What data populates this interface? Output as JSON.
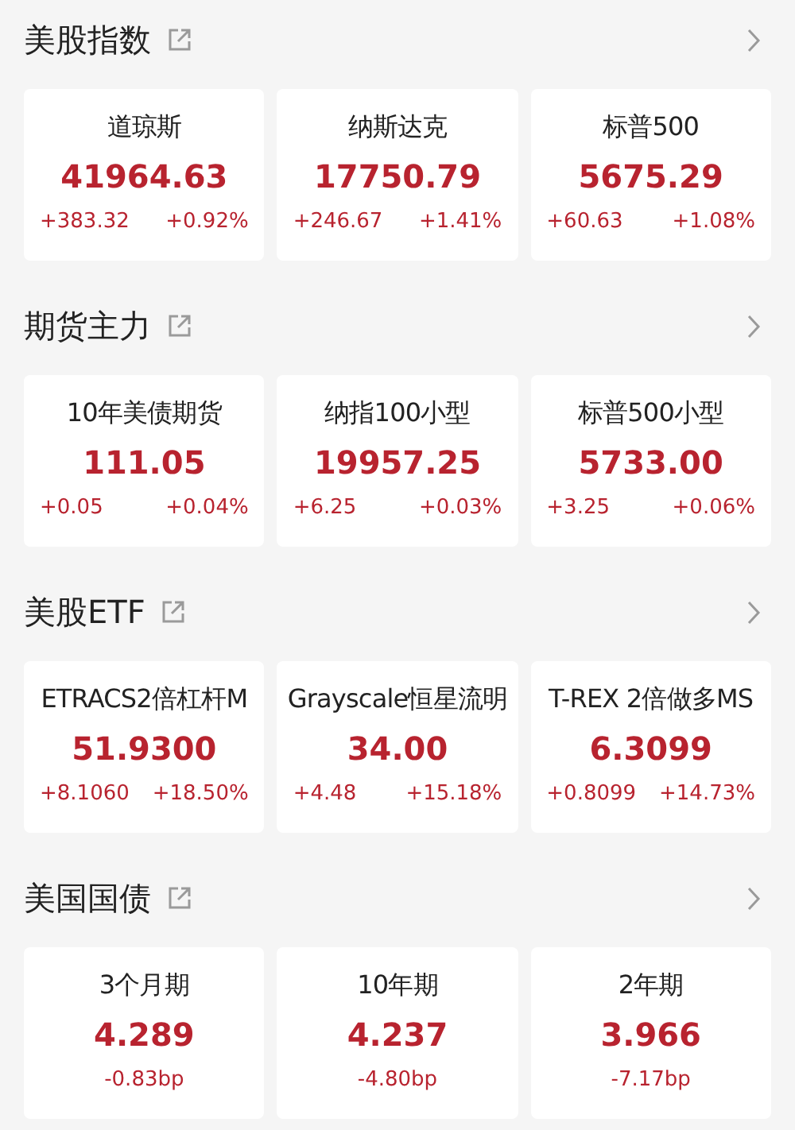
{
  "sections": [
    {
      "title": "美股指数",
      "cards": [
        {
          "name": "道琼斯",
          "value": "41964.63",
          "changes": [
            "+383.32",
            "+0.92%"
          ]
        },
        {
          "name": "纳斯达克",
          "value": "17750.79",
          "changes": [
            "+246.67",
            "+1.41%"
          ]
        },
        {
          "name": "标普500",
          "value": "5675.29",
          "changes": [
            "+60.63",
            "+1.08%"
          ]
        }
      ]
    },
    {
      "title": "期货主力",
      "cards": [
        {
          "name": "10年美债期货",
          "value": "111.05",
          "changes": [
            "+0.05",
            "+0.04%"
          ]
        },
        {
          "name": "纳指100小型",
          "value": "19957.25",
          "changes": [
            "+6.25",
            "+0.03%"
          ]
        },
        {
          "name": "标普500小型",
          "value": "5733.00",
          "changes": [
            "+3.25",
            "+0.06%"
          ]
        }
      ]
    },
    {
      "title": "美股ETF",
      "cards": [
        {
          "name": "ETRACS2倍杠杆M",
          "value": "51.9300",
          "changes": [
            "+8.1060",
            "+18.50%"
          ]
        },
        {
          "name": "Grayscale恒星流明",
          "value": "34.00",
          "changes": [
            "+4.48",
            "+15.18%"
          ]
        },
        {
          "name": "T-REX 2倍做多MS",
          "value": "6.3099",
          "changes": [
            "+0.8099",
            "+14.73%"
          ]
        }
      ]
    },
    {
      "title": "美国国债",
      "cards": [
        {
          "name": "3个月期",
          "value": "4.289",
          "changes": [
            "-0.83bp"
          ]
        },
        {
          "name": "10年期",
          "value": "4.237",
          "changes": [
            "-4.80bp"
          ]
        },
        {
          "name": "2年期",
          "value": "3.966",
          "changes": [
            "-7.17bp"
          ]
        }
      ]
    }
  ]
}
